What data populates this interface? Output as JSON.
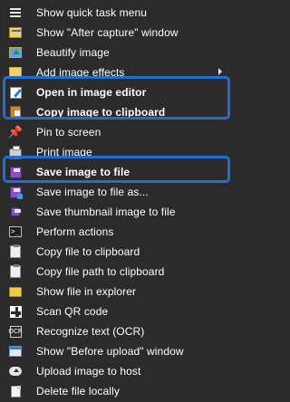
{
  "menu": {
    "items": [
      {
        "label": "Show quick task menu",
        "icon": "quick-task-menu-icon"
      },
      {
        "label": "Show \"After capture\" window",
        "icon": "after-capture-window-icon"
      },
      {
        "label": "Beautify image",
        "icon": "beautify-image-icon"
      },
      {
        "label": "Add image effects",
        "icon": "image-effects-icon",
        "submenu": true
      },
      {
        "label": "Open in image editor",
        "icon": "image-editor-icon",
        "bold": true
      },
      {
        "label": "Copy image to clipboard",
        "icon": "copy-clipboard-icon",
        "bold": true
      },
      {
        "label": "Pin to screen",
        "icon": "pin-icon"
      },
      {
        "label": "Print image",
        "icon": "print-icon"
      },
      {
        "label": "Save image to file",
        "icon": "save-icon",
        "bold": true
      },
      {
        "label": "Save image to file as...",
        "icon": "save-as-icon"
      },
      {
        "label": "Save thumbnail image to file",
        "icon": "save-thumbnail-icon"
      },
      {
        "label": "Perform actions",
        "icon": "actions-icon"
      },
      {
        "label": "Copy file to clipboard",
        "icon": "clipboard-icon"
      },
      {
        "label": "Copy file path to clipboard",
        "icon": "clipboard-path-icon"
      },
      {
        "label": "Show file in explorer",
        "icon": "folder-icon"
      },
      {
        "label": "Scan QR code",
        "icon": "qr-code-icon"
      },
      {
        "label": "Recognize text (OCR)",
        "icon": "ocr-icon"
      },
      {
        "label": "Show \"Before upload\" window",
        "icon": "before-upload-window-icon"
      },
      {
        "label": "Upload image to host",
        "icon": "upload-icon"
      },
      {
        "label": "Delete file locally",
        "icon": "delete-file-icon"
      }
    ],
    "ocr_icon_text": "OCR",
    "pin_glyph": "📌",
    "highlight_color": "#1e6ed6",
    "background_color": "#2b2b2b"
  }
}
